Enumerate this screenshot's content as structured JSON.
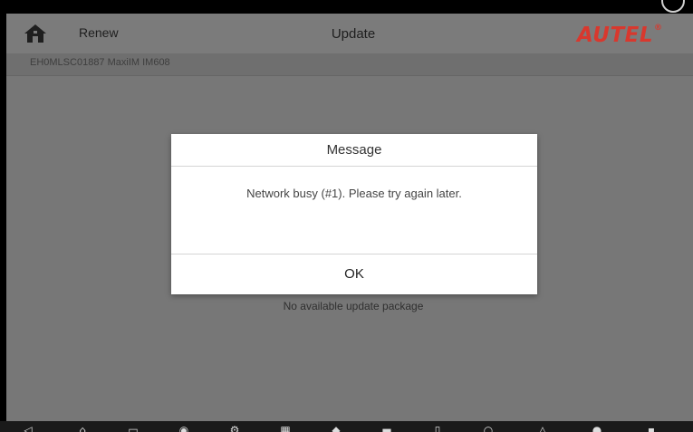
{
  "header": {
    "renew_label": "Renew",
    "title": "Update",
    "logo_text": "AUTEL",
    "logo_reg": "®"
  },
  "subheader": {
    "device_info": "EH0MLSC01887  MaxiIM IM608"
  },
  "main": {
    "empty_text": "No available update package"
  },
  "dialog": {
    "title": "Message",
    "message": "Network busy (#1). Please try again later.",
    "ok_label": "OK"
  },
  "colors": {
    "logo_red": "#d8382e",
    "dim_overlay": "#777777",
    "dialog_bg": "#ffffff"
  },
  "icons": {
    "home": "home-icon",
    "close": "close-icon"
  }
}
